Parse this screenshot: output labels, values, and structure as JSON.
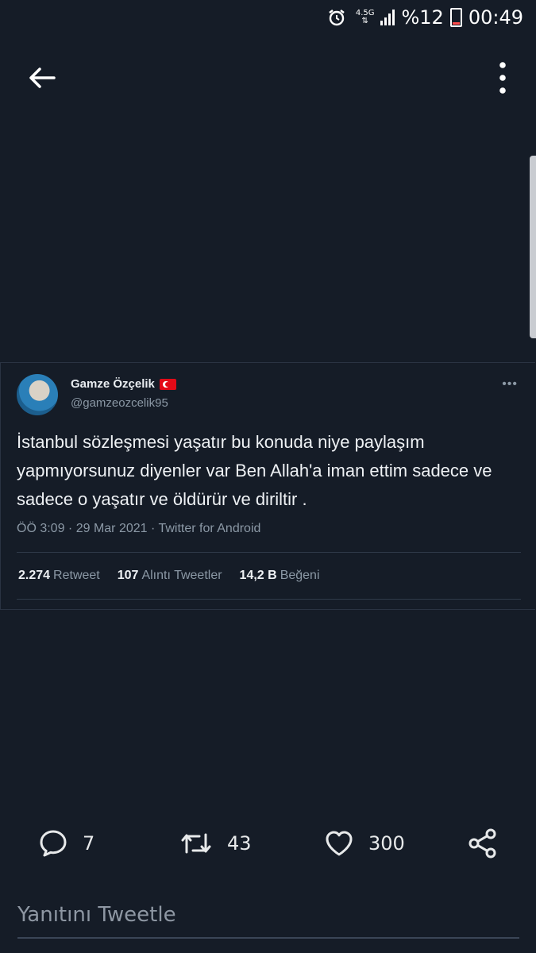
{
  "status_bar": {
    "network": "4.5G",
    "battery_percent": "%12",
    "time": "00:49"
  },
  "header": {
    "back_icon": "arrow-left-icon",
    "more_icon": "vertical-dots-icon"
  },
  "tweet": {
    "display_name": "Gamze Özçelik",
    "handle": "@gamzeozcelik95",
    "text": "İstanbul sözleşmesi yaşatır bu konuda niye paylaşım yapmıyorsunuz diyenler var Ben Allah'a iman ettim sadece ve sadece o yaşatır ve öldürür ve diriltir .",
    "timestamp": "ÖÖ 3:09 · 29 Mar 2021 · Twitter for Android",
    "stats": [
      {
        "count": "2.274",
        "label": "Retweet"
      },
      {
        "count": "107",
        "label": "Alıntı Tweetler"
      },
      {
        "count": "14,2 B",
        "label": "Beğeni"
      }
    ]
  },
  "actions": {
    "reply_count": "7",
    "retweet_count": "43",
    "like_count": "300"
  },
  "reply": {
    "placeholder": "Yanıtını Tweetle"
  },
  "colors": {
    "background": "#151c27",
    "text_primary": "#e7e9ea",
    "text_secondary": "#8b98a5",
    "flag_red": "#e30a17"
  }
}
